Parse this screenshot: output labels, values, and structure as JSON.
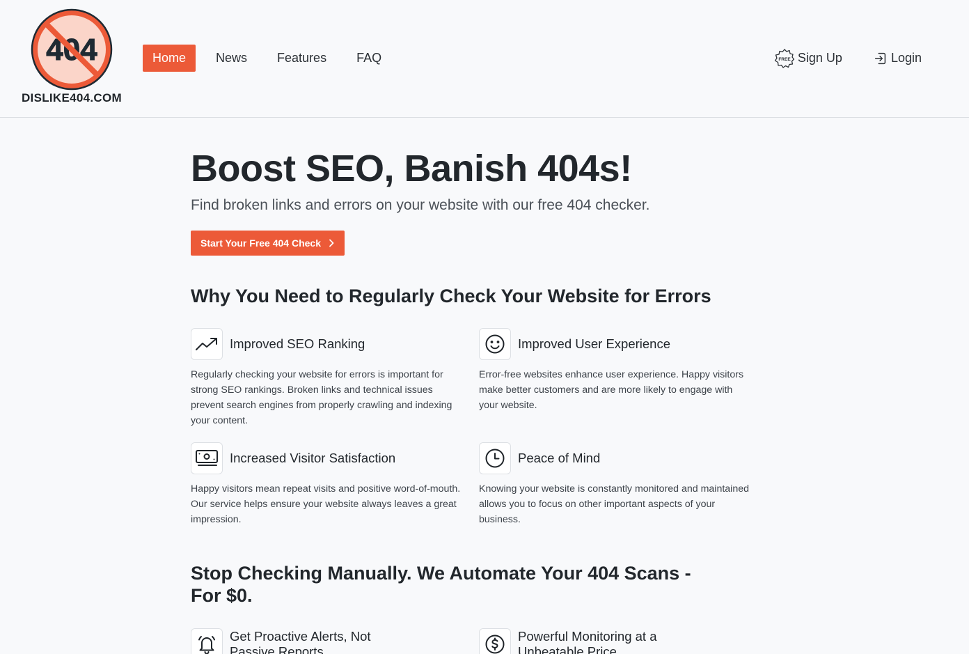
{
  "header": {
    "logo_number": "404",
    "logo_text": "DISLIKE404.COM",
    "nav": [
      {
        "label": "Home",
        "active": true
      },
      {
        "label": "News",
        "active": false
      },
      {
        "label": "Features",
        "active": false
      },
      {
        "label": "FAQ",
        "active": false
      }
    ],
    "signup_badge": "FREE",
    "signup_label": "Sign Up",
    "login_label": "Login"
  },
  "hero": {
    "title": "Boost SEO, Banish 404s!",
    "subtitle": "Find broken links and errors on your website with our free 404 checker.",
    "cta_label": "Start Your Free 404 Check"
  },
  "why": {
    "heading": "Why You Need to Regularly Check Your Website for Errors",
    "features": [
      {
        "icon": "trending-up-icon",
        "title": "Improved SEO Ranking",
        "body": "Regularly checking your website for errors is important for strong SEO rankings. Broken links and technical issues prevent search engines from properly crawling and indexing your content."
      },
      {
        "icon": "smiley-icon",
        "title": "Improved User Experience",
        "body": "Error-free websites enhance user experience. Happy visitors make better customers and are more likely to engage with your website."
      },
      {
        "icon": "cash-icon",
        "title": "Increased Visitor Satisfaction",
        "body": "Happy visitors mean repeat visits and positive word-of-mouth. Our service helps ensure your website always leaves a great impression."
      },
      {
        "icon": "clock-icon",
        "title": "Peace of Mind",
        "body": "Knowing your website is constantly monitored and maintained allows you to focus on other important aspects of your business."
      }
    ]
  },
  "automate": {
    "heading": "Stop Checking Manually. We Automate Your 404 Scans - For $0.",
    "features": [
      {
        "icon": "bell-icon",
        "title": "Get Proactive Alerts, Not Passive Reports"
      },
      {
        "icon": "dollar-icon",
        "title": "Powerful Monitoring at a Unbeatable Price"
      }
    ]
  },
  "colors": {
    "accent": "#ec5a38",
    "logo_ring": "#ec5a38",
    "text": "#22272c",
    "background": "#f8f9fb"
  }
}
